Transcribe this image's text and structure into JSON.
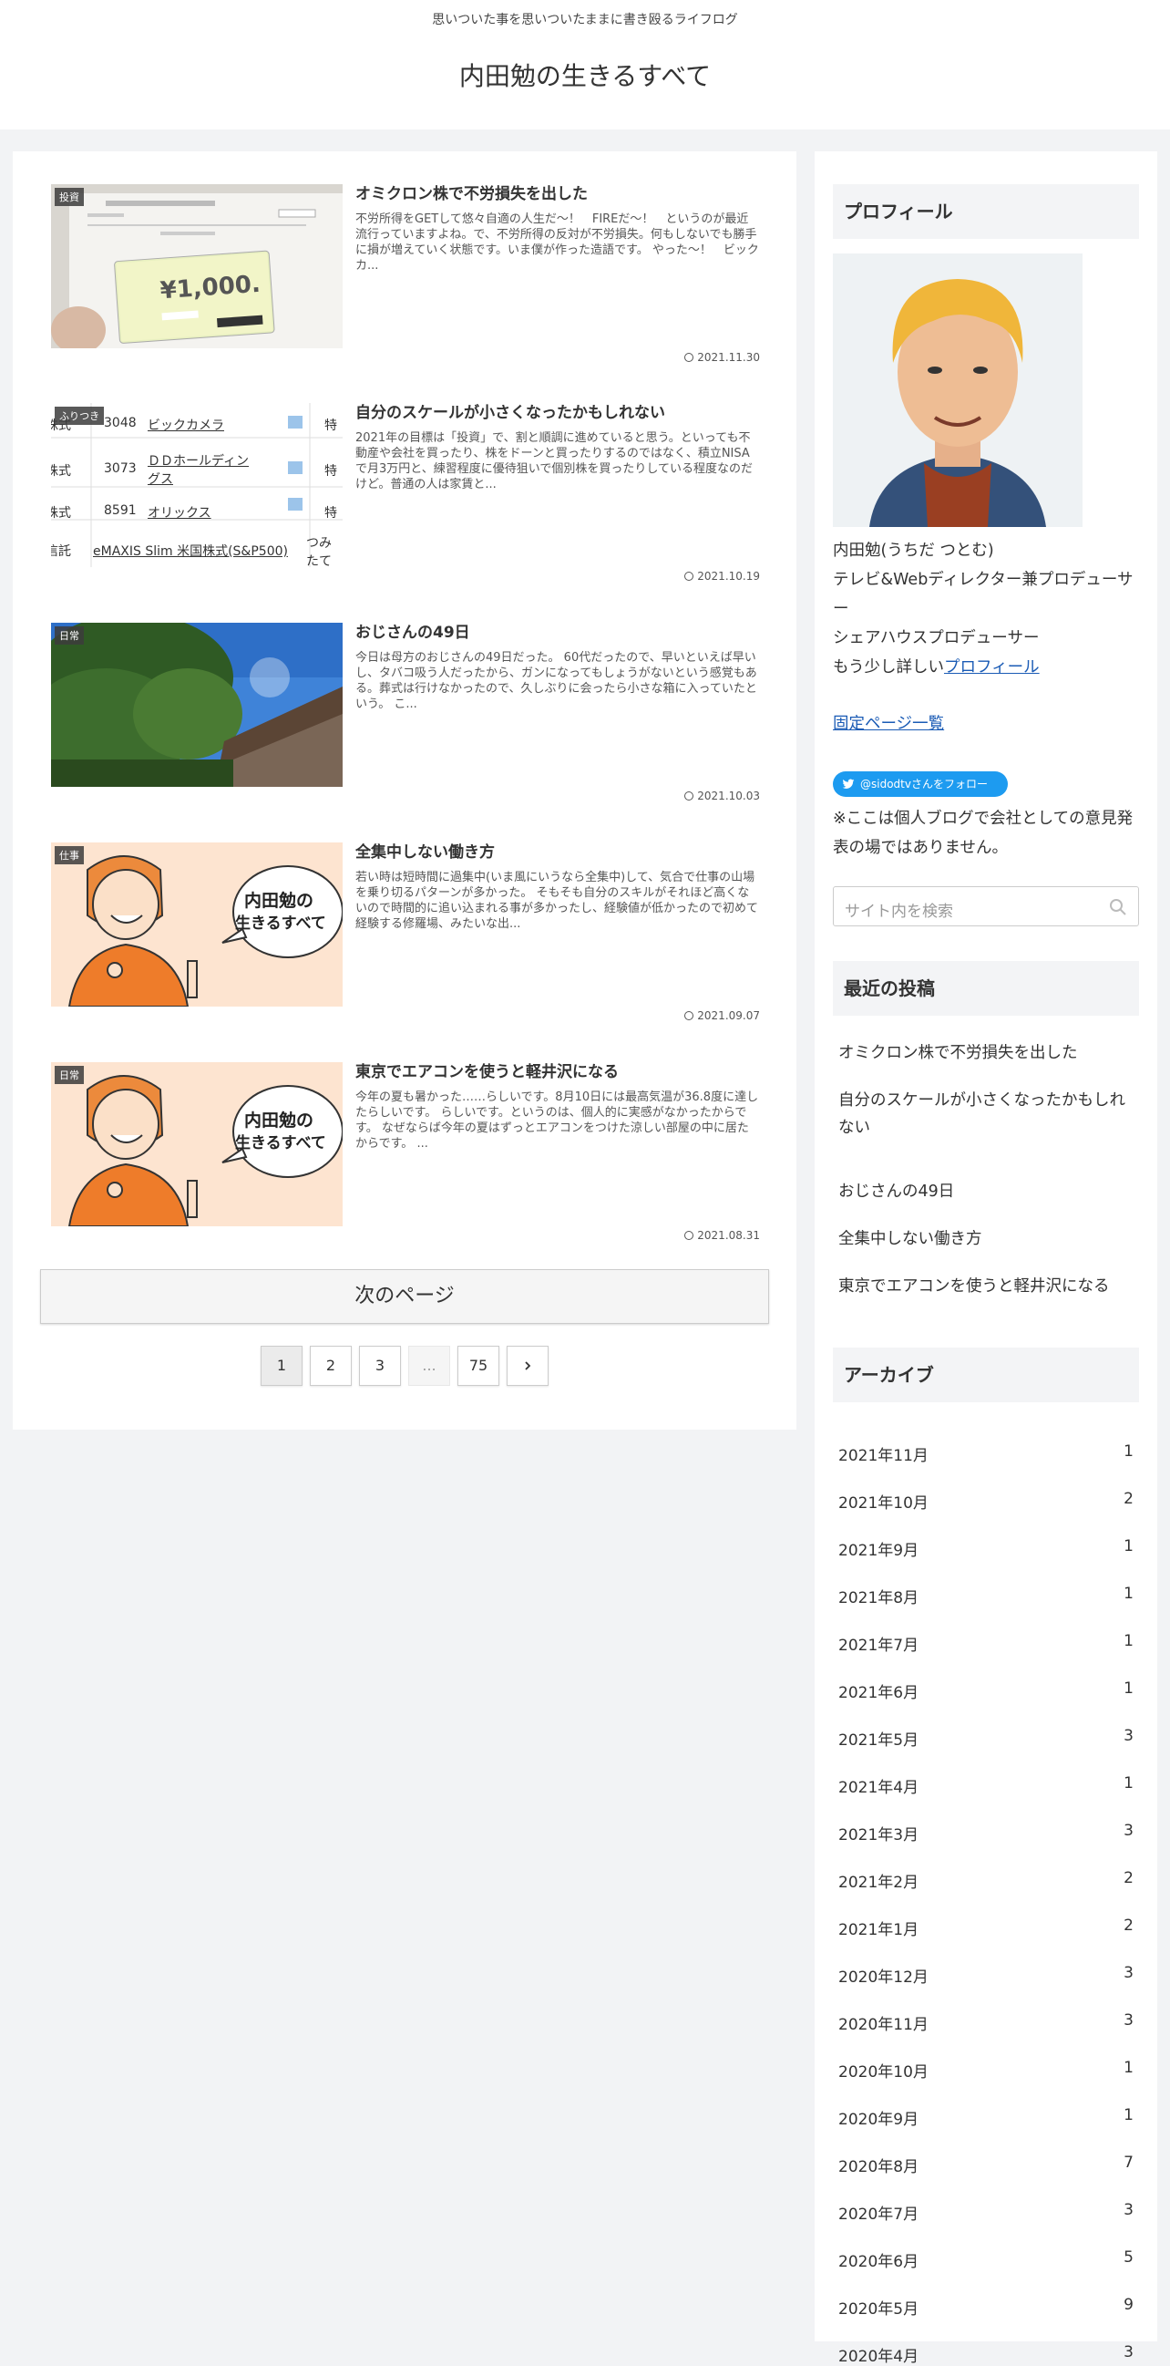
{
  "header": {
    "tagline": "思いついた事を思いついたままに書き殴るライフログ",
    "site_title": "内田勉の生きるすべて"
  },
  "entries": [
    {
      "category": "投資",
      "title": "オミクロン株で不労損失を出した",
      "snippet": "不労所得をGETして悠々自適の人生だ〜！　FIREだ〜！　というのが最近流行っていますよね。で、不労所得の反対が不労損失。何もしないでも勝手に損が増えていく状態です。いま僕が作った造語です。 やった〜！　ビックカ...",
      "date": "2021.11.30",
      "thumb": "voucher"
    },
    {
      "category": "ふりつき",
      "title": "自分のスケールが小さくなったかもしれない",
      "snippet": "2021年の目標は「投資」で、割と順調に進めていると思う。といっても不動産や会社を買ったり、株をドーンと買ったりするのではなく、積立NISAで月3万円と、練習程度に優待狙いで個別株を買ったりしている程度なのだけど。普通の人は家賃と...",
      "date": "2021.10.19",
      "thumb": "table",
      "table_rows": [
        {
          "type": "株式",
          "code": "3048",
          "name": "ビックカメラ",
          "tail": "特"
        },
        {
          "type": "株式",
          "code": "3073",
          "name": "ＤＤホールディングス",
          "tail": "特"
        },
        {
          "type": "株式",
          "code": "8591",
          "name": "オリックス",
          "tail": "特"
        },
        {
          "type": "信託",
          "code": "",
          "name": "eMAXIS Slim 米国株式(S&P500)",
          "tail": "つみたてNISA"
        }
      ]
    },
    {
      "category": "日常",
      "title": "おじさんの49日",
      "snippet": "今日は母方のおじさんの49日だった。 60代だったので、早いといえば早いし、タバコ吸う人だったから、ガンになってもしょうがないという感覚もある。葬式は行けなかったので、久しぶりに会ったら小さな箱に入っていたという。 こ...",
      "date": "2021.10.03",
      "thumb": "temple"
    },
    {
      "category": "仕事",
      "title": "全集中しない働き方",
      "snippet": "若い時は短時間に過集中(いま風にいうなら全集中)して、気合で仕事の山場を乗り切るパターンが多かった。 そもそも自分のスキルがそれほど高くないので時間的に追い込まれる事が多かったし、経験値が低かったので初めて経験する修羅場、みたいな出...",
      "date": "2021.09.07",
      "thumb": "cartoon",
      "bubble": [
        "内田勉の",
        "生きるすべて"
      ]
    },
    {
      "category": "日常",
      "title": "東京でエアコンを使うと軽井沢になる",
      "snippet": "今年の夏も暑かった……らしいです。8月10日には最高気温が36.8度に達したらしいです。 らしいです。というのは、個人的に実感がなかったからです。 なぜならば今年の夏はずっとエアコンをつけた涼しい部屋の中に居たからです。 ...",
      "date": "2021.08.31",
      "thumb": "cartoon",
      "bubble": [
        "内田勉の",
        "生きるすべて"
      ]
    }
  ],
  "pagination": {
    "next_label": "次のページ",
    "pages": [
      "1",
      "2",
      "3",
      "...",
      "75"
    ],
    "next_icon": "chevron-right-icon"
  },
  "voucher": {
    "amount": "¥1,000."
  },
  "sidebar": {
    "profile_title": "プロフィール",
    "profile_name": "内田勉(うちだ つとむ)",
    "profile_role": "テレビ&Webディレクター兼プロデューサー",
    "profile_role2": "シェアハウスプロデューサー",
    "profile_more": "もう少し詳しい",
    "profile_link": "プロフィール",
    "fixed_pages_link": "固定ページ一覧",
    "twitter_follow": "@sidodtvさんをフォロー",
    "note": "※ここは個人ブログで会社としての意見発表の場ではありません。",
    "search_placeholder": "サイト内を検索",
    "recent_title": "最近の投稿",
    "recent": [
      "オミクロン株で不労損失を出した",
      "自分のスケールが小さくなったかもしれない",
      "おじさんの49日",
      "全集中しない働き方",
      "東京でエアコンを使うと軽井沢になる"
    ],
    "archive_title": "アーカイブ",
    "archives": [
      {
        "month": "2021年11月",
        "count": "1"
      },
      {
        "month": "2021年10月",
        "count": "2"
      },
      {
        "month": "2021年9月",
        "count": "1"
      },
      {
        "month": "2021年8月",
        "count": "1"
      },
      {
        "month": "2021年7月",
        "count": "1"
      },
      {
        "month": "2021年6月",
        "count": "1"
      },
      {
        "month": "2021年5月",
        "count": "3"
      },
      {
        "month": "2021年4月",
        "count": "1"
      },
      {
        "month": "2021年3月",
        "count": "3"
      },
      {
        "month": "2021年2月",
        "count": "2"
      },
      {
        "month": "2021年1月",
        "count": "2"
      },
      {
        "month": "2020年12月",
        "count": "3"
      },
      {
        "month": "2020年11月",
        "count": "3"
      },
      {
        "month": "2020年10月",
        "count": "1"
      },
      {
        "month": "2020年9月",
        "count": "1"
      },
      {
        "month": "2020年8月",
        "count": "7"
      },
      {
        "month": "2020年7月",
        "count": "3"
      },
      {
        "month": "2020年6月",
        "count": "5"
      },
      {
        "month": "2020年5月",
        "count": "9"
      },
      {
        "month": "2020年4月",
        "count": "3"
      }
    ]
  }
}
